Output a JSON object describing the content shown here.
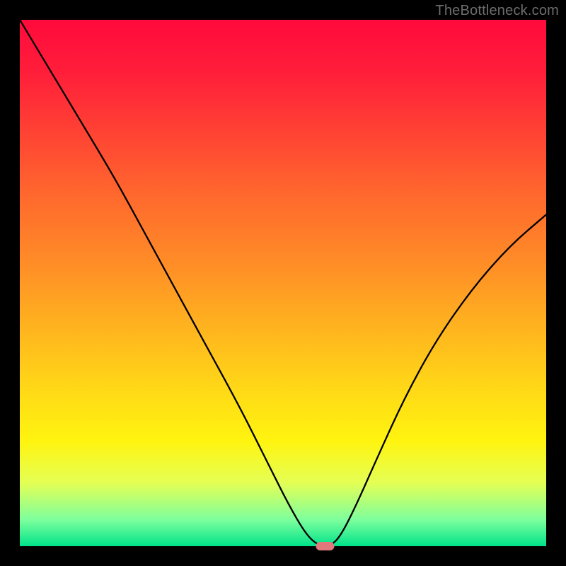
{
  "watermark": "TheBottleneck.com",
  "chart_data": {
    "type": "line",
    "title": "",
    "xlabel": "",
    "ylabel": "",
    "xlim": [
      0,
      100
    ],
    "ylim": [
      0,
      100
    ],
    "grid": false,
    "legend": false,
    "series": [
      {
        "name": "bottleneck-curve",
        "x": [
          0,
          6,
          12,
          18,
          24,
          30,
          36,
          42,
          47,
          51,
          54.5,
          57,
          59,
          61,
          64,
          68,
          73,
          79,
          86,
          93,
          100
        ],
        "values": [
          100,
          90,
          80,
          70,
          59,
          48,
          37,
          26,
          16,
          8,
          2,
          0,
          0,
          2,
          8,
          17,
          28,
          39,
          49,
          57,
          63
        ]
      }
    ],
    "marker": {
      "x": 58,
      "y": 0,
      "shape": "pill",
      "color": "#e0787c"
    },
    "gradient_stops": [
      {
        "pos": 0.0,
        "color": "#ff0a3c"
      },
      {
        "pos": 0.1,
        "color": "#ff1e3a"
      },
      {
        "pos": 0.22,
        "color": "#ff4433"
      },
      {
        "pos": 0.34,
        "color": "#ff6a2d"
      },
      {
        "pos": 0.46,
        "color": "#ff8c27"
      },
      {
        "pos": 0.58,
        "color": "#ffb21f"
      },
      {
        "pos": 0.7,
        "color": "#ffd817"
      },
      {
        "pos": 0.8,
        "color": "#fff40f"
      },
      {
        "pos": 0.88,
        "color": "#e4ff55"
      },
      {
        "pos": 0.95,
        "color": "#7dff9d"
      },
      {
        "pos": 1.0,
        "color": "#00e28a"
      }
    ]
  }
}
